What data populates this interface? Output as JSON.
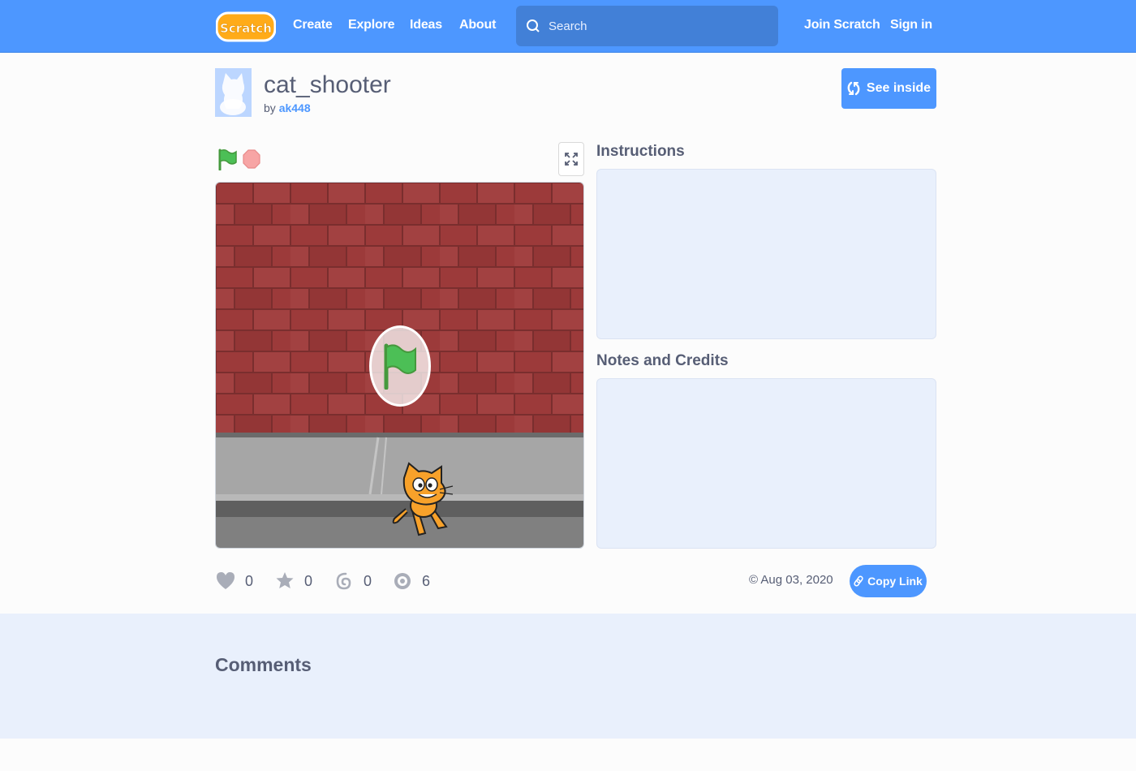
{
  "navbar": {
    "logo_text": "Scratch",
    "links": [
      "Create",
      "Explore",
      "Ideas",
      "About"
    ],
    "search_placeholder": "Search",
    "join": "Join Scratch",
    "signin": "Sign in"
  },
  "project": {
    "title": "cat_shooter",
    "by_label": "by",
    "author": "ak448",
    "see_inside": "See inside"
  },
  "side": {
    "instructions_label": "Instructions",
    "notes_label": "Notes and Credits"
  },
  "stats": {
    "loves": "0",
    "favorites": "0",
    "remixes": "0",
    "views": "6"
  },
  "footer_bar": {
    "date": "Aug 03, 2020",
    "copy_link": "Copy Link"
  },
  "comments": {
    "title": "Comments"
  },
  "colors": {
    "brand": "#4d97ff",
    "panel": "#e9f0fc",
    "text": "#575e75",
    "brick": "#9c3a3a",
    "flag_green": "#4cbf56"
  }
}
